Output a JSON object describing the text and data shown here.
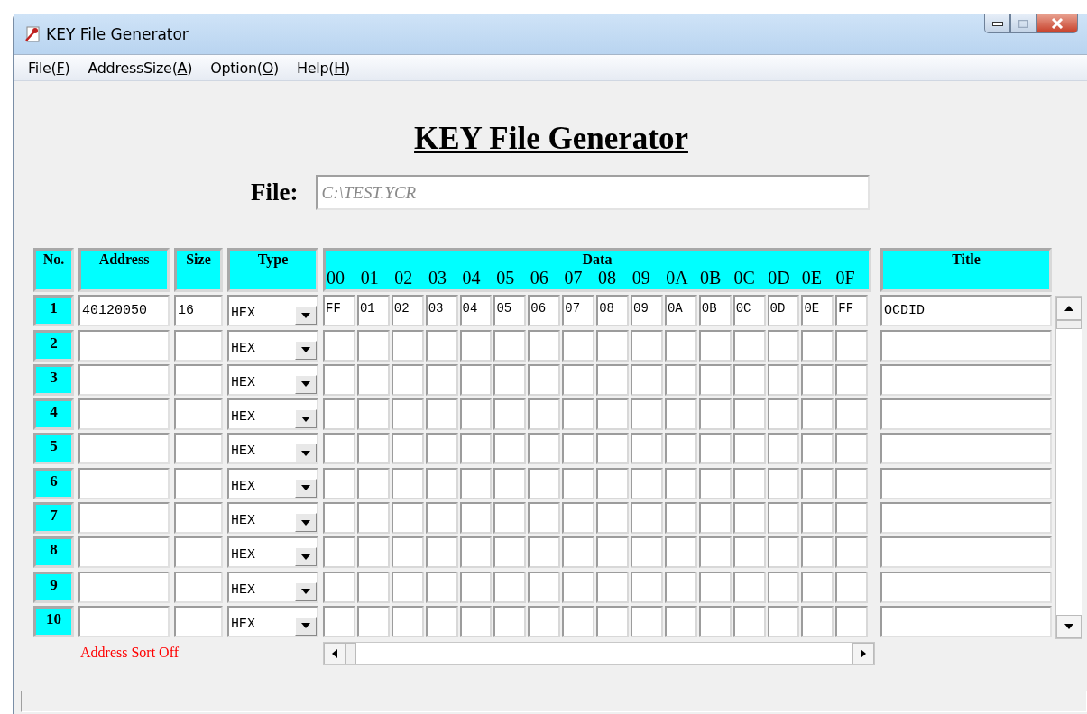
{
  "window": {
    "title": "KEY File Generator"
  },
  "menu": [
    {
      "label": "File(",
      "key": "F",
      "end": ")"
    },
    {
      "label": "AddressSize(",
      "key": "A",
      "end": ")"
    },
    {
      "label": "Option(",
      "key": "O",
      "end": ")"
    },
    {
      "label": "Help(",
      "key": "H",
      "end": ")"
    }
  ],
  "heading": "KEY File Generator",
  "file": {
    "label": "File:",
    "value": "C:\\TEST.YCR"
  },
  "table": {
    "columns": {
      "no": "No.",
      "address": "Address",
      "size": "Size",
      "type": "Type",
      "data": "Data",
      "title": "Title"
    },
    "data_columns": [
      "00",
      "01",
      "02",
      "03",
      "04",
      "05",
      "06",
      "07",
      "08",
      "09",
      "0A",
      "0B",
      "0C",
      "0D",
      "0E",
      "0F"
    ],
    "rows": [
      {
        "no": "1",
        "address": "40120050",
        "size": "16",
        "type": "HEX",
        "data": [
          "FF",
          "01",
          "02",
          "03",
          "04",
          "05",
          "06",
          "07",
          "08",
          "09",
          "0A",
          "0B",
          "0C",
          "0D",
          "0E",
          "FF"
        ],
        "title": "OCDID"
      },
      {
        "no": "2",
        "type": "HEX"
      },
      {
        "no": "3",
        "type": "HEX"
      },
      {
        "no": "4",
        "type": "HEX"
      },
      {
        "no": "5",
        "type": "HEX"
      },
      {
        "no": "6",
        "type": "HEX"
      },
      {
        "no": "7",
        "type": "HEX"
      },
      {
        "no": "8",
        "type": "HEX"
      },
      {
        "no": "9",
        "type": "HEX"
      },
      {
        "no": "10",
        "type": "HEX"
      }
    ]
  },
  "sort_status": "Address Sort Off"
}
